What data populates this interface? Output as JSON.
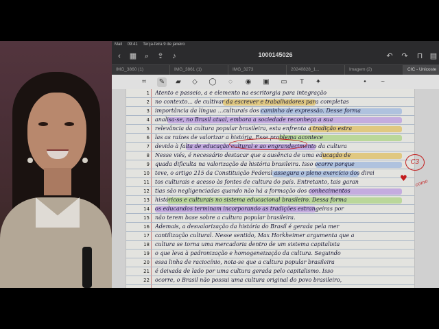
{
  "status_bar": {
    "carrier": "Mail",
    "time": "09:41",
    "date": "Terça-feira 9 de janeiro"
  },
  "nav": {
    "title": "1000145026",
    "back_icon": "chevron-left-icon",
    "icons": [
      "grid-icon",
      "search-icon",
      "share-icon",
      "mic-icon",
      "undo-icon",
      "redo-icon",
      "bookmark-icon",
      "pages-icon"
    ]
  },
  "tabs": [
    {
      "label": "IMG_3860 (1)",
      "active": false
    },
    {
      "label": "IMG_3861 (1)",
      "active": false
    },
    {
      "label": "IMG_3273",
      "active": false
    },
    {
      "label": "20240828_1...",
      "active": false
    },
    {
      "label": "Imagem (2)",
      "active": false
    },
    {
      "label": "CIC - Unicoste",
      "active": true
    }
  ],
  "toolbar_icons": [
    "lasso-icon",
    "pen-icon",
    "highlighter-icon",
    "eraser-icon",
    "shape-icon",
    "lasso-select-icon",
    "image-icon",
    "camera-icon",
    "sticker-icon",
    "text-icon",
    "magic-icon",
    "dot-icon",
    "wave-icon"
  ],
  "page": {
    "lines": [
      {
        "n": "1",
        "text": "Atento e passeio, a e elemento na escritorgia para integração"
      },
      {
        "n": "2",
        "text": "no contexto... de cultivar da escrever e trabalhadores para completas"
      },
      {
        "n": "3",
        "text": "importância da língua ...culturais dos caminho de expressão. Desse forma"
      },
      {
        "n": "4",
        "text": "analisa-se, no Brasil atual, embora a sociedade reconheça a sua"
      },
      {
        "n": "5",
        "text": "relevância da cultura popular brasileira, esta enfrenta a tradição estra"
      },
      {
        "n": "6",
        "text": "las as raízes de valorizar a história, Esse problema acontece"
      },
      {
        "n": "7",
        "text": "devido à falta de educação cultural e ao engrandecimento da cultura"
      },
      {
        "n": "8",
        "text": "Nesse viés, é necessário destacar que a ausência de uma educação de"
      },
      {
        "n": "9",
        "text": "quada dificulta na valorização da história brasileira. Isso ocorre porque"
      },
      {
        "n": "10",
        "text": "teve, o artigo 215 da Constituição Federal assegura o pleno exercício dos direi"
      },
      {
        "n": "11",
        "text": "tos culturais e acesso às fontes de cultura do país. Entretanto, tais garan"
      },
      {
        "n": "12",
        "text": "tias são negligenciadas quando não há a formação dos conhecimentos"
      },
      {
        "n": "13",
        "text": "históricos e culturais no sistema educacional brasileiro. Dessa forma"
      },
      {
        "n": "14",
        "text": "os educandos terminam incorporando as tradições estrangeiras por"
      },
      {
        "n": "15",
        "text": "não terem base sobre a cultura popular brasileira."
      },
      {
        "n": "16",
        "text": "Ademais, a desvalorização da história do Brasil é gerada pela mer"
      },
      {
        "n": "17",
        "text": "cantilização cultural. Nesse sentido, Max Horkheimer argumenta que a"
      },
      {
        "n": "18",
        "text": "cultura se torna uma mercadoria dentro de um sistema capitalista"
      },
      {
        "n": "19",
        "text": "o que leva à padronização e homogeneização da cultura. Seguindo"
      },
      {
        "n": "20",
        "text": "essa linha de raciocínio, nota-se que a cultura popular brasileira"
      },
      {
        "n": "21",
        "text": "é deixada de lado por uma cultura gerada pelo capitalismo. Isso"
      },
      {
        "n": "22",
        "text": "ocorre, o Brasil não possui uma cultura original do povo brasileiro,"
      }
    ],
    "circled_phrase": "educação cultural",
    "annotation": {
      "grade": "C3",
      "word": "como"
    }
  }
}
